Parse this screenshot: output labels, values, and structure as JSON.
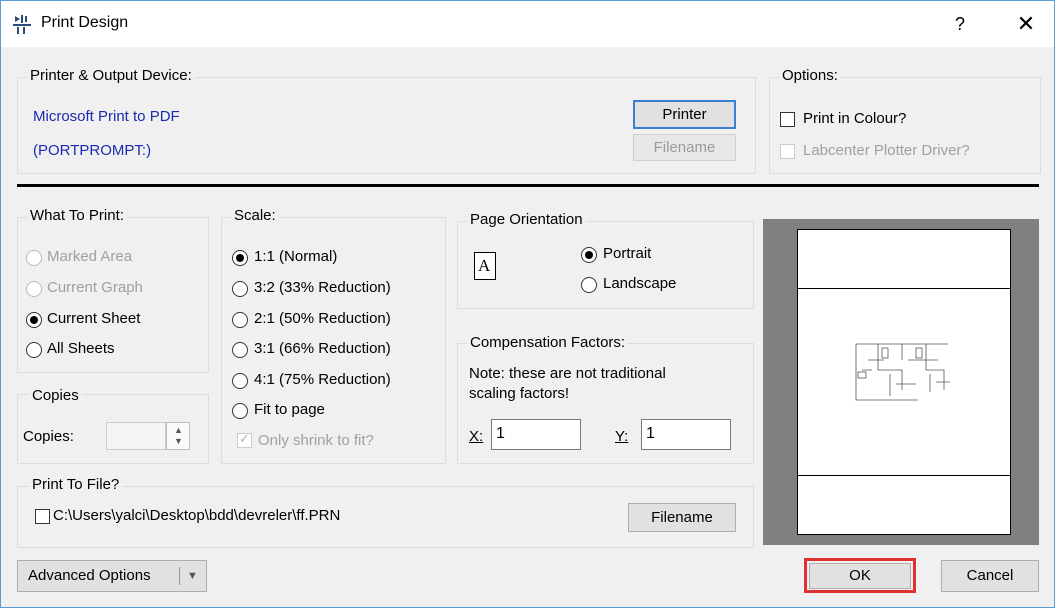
{
  "title": "Print Design",
  "titlebar": {
    "help": "?",
    "close": "✕"
  },
  "printer_group": {
    "label": "Printer & Output Device:",
    "device_name": "Microsoft Print to PDF",
    "device_port": "(PORTPROMPT:)",
    "printer_button": "Printer",
    "filename_button": "Filename"
  },
  "options_group": {
    "label": "Options:",
    "print_colour": "Print in Colour?",
    "plotter_driver": "Labcenter Plotter Driver?"
  },
  "what_to_print": {
    "label": "What To Print:",
    "items": [
      "Marked Area",
      "Current Graph",
      "Current Sheet",
      "All Sheets"
    ],
    "selected": "Current Sheet"
  },
  "copies": {
    "label": "Copies",
    "field_label": "Copies:",
    "value": ""
  },
  "scale": {
    "label": "Scale:",
    "items": [
      "1:1 (Normal)",
      "3:2 (33% Reduction)",
      "2:1 (50% Reduction)",
      "3:1 (66% Reduction)",
      "4:1 (75% Reduction)",
      "Fit to page"
    ],
    "selected": "1:1 (Normal)",
    "shrink": "Only shrink to fit?"
  },
  "orientation": {
    "label": "Page Orientation",
    "glyph": "A",
    "portrait": "Portrait",
    "landscape": "Landscape",
    "selected": "Portrait"
  },
  "compensation": {
    "label": "Compensation Factors:",
    "note_line1": "Note: these are not traditional",
    "note_line2": "scaling factors!",
    "x_label": "X:",
    "x_value": "1",
    "y_label": "Y:",
    "y_value": "1"
  },
  "print_to_file": {
    "label": "Print To File?",
    "path": "C:\\Users\\yalci\\Desktop\\bdd\\devreler\\ff.PRN",
    "filename_button": "Filename"
  },
  "footer": {
    "advanced": "Advanced Options",
    "ok": "OK",
    "cancel": "Cancel"
  },
  "colors": {
    "highlight": "#e03030",
    "link_blue": "#1a2bb0",
    "accent": "#3c7fd0"
  }
}
